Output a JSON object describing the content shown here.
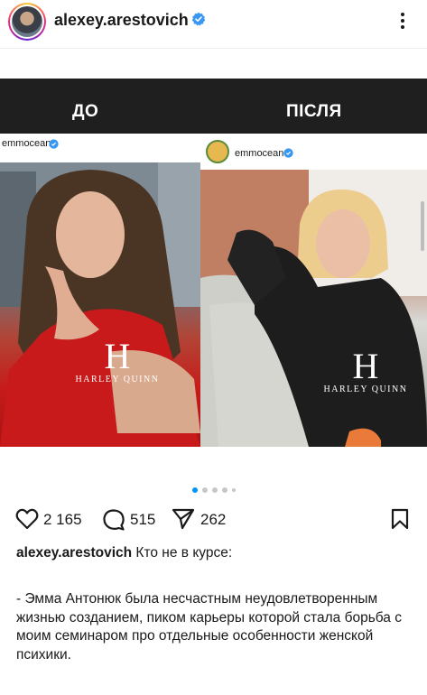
{
  "header": {
    "username": "alexey.arestovich",
    "verified_icon": "verified-badge-icon",
    "more_icon": "more-options-icon"
  },
  "post": {
    "before_label": "ДО",
    "after_label": "ПІСЛЯ",
    "left_image": {
      "username": "emmocean",
      "watermark_mark": "H",
      "watermark_text": "HARLEY QUINN"
    },
    "right_image": {
      "username": "emmocean",
      "watermark_mark": "H",
      "watermark_text": "HARLEY QUINN"
    },
    "carousel": {
      "count": 5,
      "active_index": 0
    }
  },
  "actions": {
    "likes": "2 165",
    "comments": "515",
    "shares": "262"
  },
  "caption": {
    "author": "alexey.arestovich",
    "first_line": "Кто не в курсе:",
    "body": "- Эмма Антонюк была несчастным неудовлетворенным жизнью созданием, пиком карьеры которой стала борьба с моим семинаром про отдельные особенности женской психики."
  },
  "colors": {
    "verified": "#3897f0",
    "accent_dot": "#0095f6",
    "band": "#1f1f1f"
  }
}
